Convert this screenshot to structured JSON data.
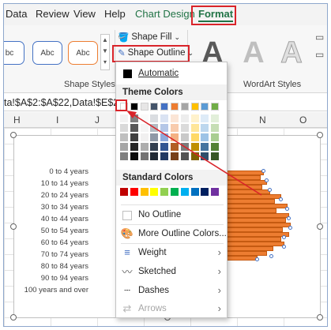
{
  "tabs": {
    "data": "Data",
    "review": "Review",
    "view": "View",
    "help": "Help",
    "chart_design": "Chart Design",
    "format": "Format"
  },
  "ribbon": {
    "shape_styles": {
      "box1": "bc",
      "box2": "Abc",
      "box3": "Abc",
      "label": "Shape Styles"
    },
    "shape_fill": "Shape Fill",
    "shape_outline": "Shape Outline",
    "wordart_label": "WordArt Styles",
    "wordart_letter": "A"
  },
  "formula_text": "ta!$A$2:$A$22,Data!$E$2:$",
  "columns": [
    "H",
    "I",
    "J",
    "N",
    "O"
  ],
  "chart": {
    "categories": [
      "0 to 4 years",
      "10 to 14 years",
      "20 to 24 years",
      "30 to 34 years",
      "40 to 44 years",
      "50 to 54 years",
      "60 to 64 years",
      "70 to 74 years",
      "80 to 84 years",
      "90 to 94 years",
      "100 years and over"
    ]
  },
  "dropdown": {
    "automatic": "Automatic",
    "theme_colors": "Theme Colors",
    "standard_colors": "Standard Colors",
    "no_outline": "No Outline",
    "more_colors": "More Outline Colors...",
    "weight": "Weight",
    "sketched": "Sketched",
    "dashes": "Dashes",
    "arrows": "Arrows"
  },
  "colors": {
    "theme_top": [
      "#ffffff",
      "#000000",
      "#e7e6e6",
      "#44546a",
      "#4472c4",
      "#ed7d31",
      "#a5a5a5",
      "#ffc000",
      "#5b9bd5",
      "#70ad47"
    ],
    "standard": [
      "#c00000",
      "#ff0000",
      "#ffc000",
      "#ffff00",
      "#92d050",
      "#00b050",
      "#00b0f0",
      "#0070c0",
      "#002060",
      "#7030a0"
    ],
    "accent": "#217346",
    "highlight": "#d9242a"
  }
}
